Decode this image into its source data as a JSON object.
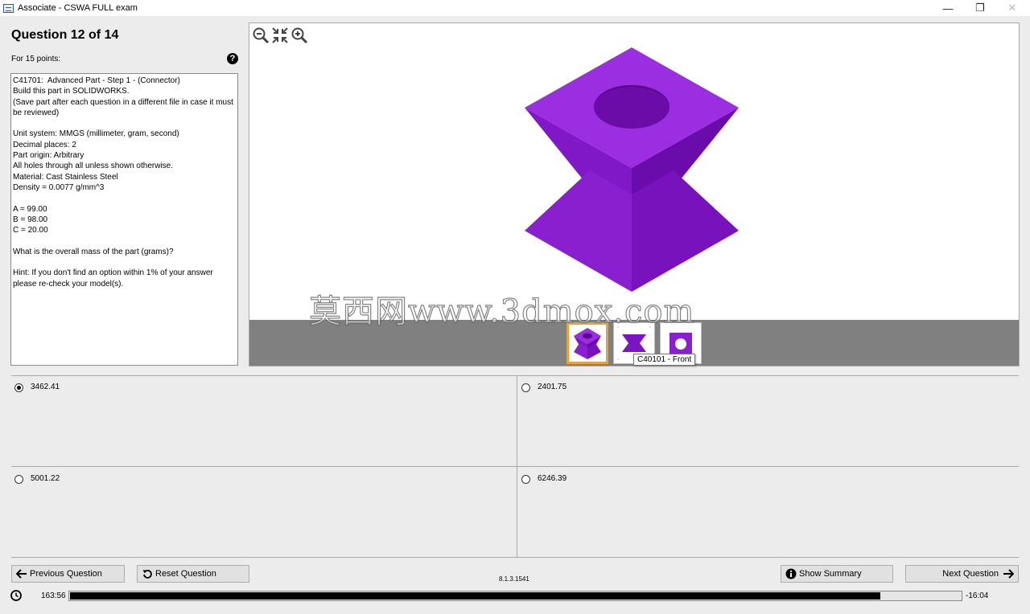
{
  "window": {
    "title": "Associate - CSWA FULL exam",
    "controls": {
      "minimize": "—",
      "maximize": "❐",
      "close": "✕"
    }
  },
  "question": {
    "title": "Question 12 of 14",
    "points": "For 15 points:",
    "help_glyph": "?",
    "text": "C41701:  Advanced Part - Step 1 - (Connector)\nBuild this part in SOLIDWORKS.\n(Save part after each question in a different file in case it must be reviewed)\n\nUnit system: MMGS (millimeter, gram, second)\nDecimal places: 2\nPart origin: Arbitrary\nAll holes through all unless shown otherwise.\nMaterial: Cast Stainless Steel\nDensity = 0.0077 g/mm^3\n\nA = 99.00\nB = 98.00\nC = 20.00\n\nWhat is the overall mass of the part (grams)?\n\nHint: If you don't find an option within 1% of your answer please re-check your model(s)."
  },
  "viewer": {
    "tooltip": "C40101 - Front",
    "watermark": "莫西网www.3dmox.com",
    "model_color": "#8a1fd0",
    "thumbnails": [
      {
        "icon": "isometric-view-icon",
        "selected": true
      },
      {
        "icon": "front-view-icon",
        "selected": false
      },
      {
        "icon": "top-view-icon",
        "selected": false
      }
    ]
  },
  "answers": [
    {
      "label": "3462.41",
      "selected": true
    },
    {
      "label": "2401.75",
      "selected": false
    },
    {
      "label": "5001.22",
      "selected": false
    },
    {
      "label": "6246.39",
      "selected": false
    }
  ],
  "buttons": {
    "previous": "Previous Question",
    "reset": "Reset Question",
    "summary": "Show Summary",
    "next": "Next Question"
  },
  "version": "8.1.3.1541",
  "timer": {
    "elapsed": "163:56",
    "remaining": "-16:04",
    "progress_percent": 91
  }
}
